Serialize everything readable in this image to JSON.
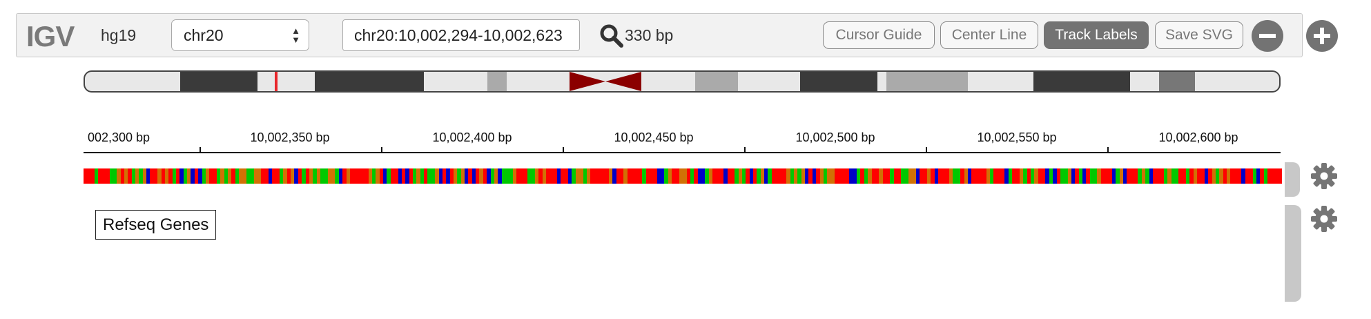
{
  "app": {
    "logo_text": "IGV",
    "genome": "hg19",
    "chromosome": {
      "selected": "chr20"
    },
    "locus": {
      "value": "chr20:10,002,294-10,002,623"
    },
    "window_width": "330 bp",
    "buttons": {
      "cursor_guide": "Cursor Guide",
      "center_line": "Center Line",
      "track_labels": "Track Labels",
      "save_svg": "Save SVG"
    },
    "active_button": "track_labels",
    "zoom_out_icon": "minus-circle-icon",
    "zoom_in_icon": "plus-circle-icon",
    "search_icon": "search-icon"
  },
  "ideogram": {
    "current_region_marker_color": "#e8262b",
    "centromere_color": "#8b0000"
  },
  "ruler": {
    "ticks": [
      {
        "label": "002,300 bp"
      },
      {
        "label": "10,002,350 bp"
      },
      {
        "label": "10,002,400 bp"
      },
      {
        "label": "10,002,450 bp"
      },
      {
        "label": "10,002,500 bp"
      },
      {
        "label": "10,002,550 bp"
      },
      {
        "label": "10,002,600 bp"
      }
    ]
  },
  "sequence_track": {
    "base_colors": {
      "A": "#00c800",
      "C": "#0000c8",
      "G": "#d17105",
      "T": "#ff0000"
    },
    "bases": "TTTATTTAAGTGTAGAGCTTGTGTATCAGCTCAGTTAGAGTAGGAAGGTTCTTAGTGCTATGAGAAGGACTGTTTTTGAGTCATTCTCTAGATAAGCTCTGAGCTCTGTCAGCAAAGTTTAAGTGTTTCTTCAGGAGTTTTTGCTTGTTTTATTTCCAGTTGGTATCCAGTTTCTTAGATCTAGCATTTTGAGAGCTCTGAGGTTTTCCATAGTTGTTATTAAGGCTTGTCTTTGAATGCTTTTGATTTCATTGATAGTTCACTAAGCTACTAAGTTTCAGCTTTAGACTTTAGAATTATGTTCTGAGTGTTTCTTACTATTTT"
  },
  "tracks": [
    {
      "name": "Refseq Genes"
    }
  ],
  "track_gear_icon": "gear-icon"
}
